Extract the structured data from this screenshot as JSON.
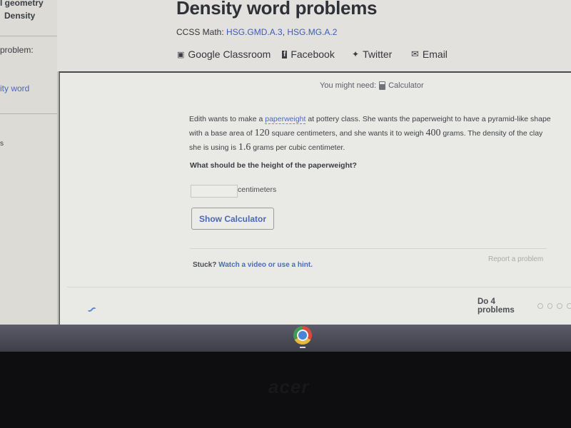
{
  "sidebar": {
    "course_partial": "l geometry",
    "current_topic": "Density",
    "problem_label": "problem:",
    "link_partial": "ity word",
    "bottom_partial": "s"
  },
  "header": {
    "title": "Density word problems",
    "ccss_label": "CCSS Math:",
    "standards": [
      "HSG.GMD.A.3",
      "HSG.MG.A.2"
    ],
    "share": [
      {
        "icon": "google-classroom-icon",
        "label": "Google Classroom"
      },
      {
        "icon": "facebook-icon",
        "label": "Facebook"
      },
      {
        "icon": "twitter-icon",
        "label": "Twitter"
      },
      {
        "icon": "email-icon",
        "label": "Email"
      }
    ]
  },
  "exercise": {
    "might_need_label": "You might need:",
    "tool": "Calculator",
    "problem": {
      "p1": "Edith wants to make a ",
      "term": "paperweight",
      "p2": " at pottery class. She wants the paperweight to have a pyramid-like shape with a base area of ",
      "base_area": "120",
      "p3": " square centimeters, and she wants it to weigh ",
      "weight": "400",
      "p4": " grams. The density of the clay she is using is ",
      "density": "1.6",
      "p5": " grams per cubic centimeter."
    },
    "question": "What should be the height of the paperweight?",
    "answer_value": "",
    "answer_unit": "centimeters",
    "show_calculator_label": "Show Calculator",
    "stuck_label": "Stuck?",
    "hint_link": "Watch a video or use a hint.",
    "report_label": "Report a problem",
    "progress_label": "Do 4 problems",
    "progress_total": 4,
    "progress_done": 0
  },
  "taskbar": {
    "app": "Chrome"
  },
  "device": {
    "brand": "acer"
  }
}
